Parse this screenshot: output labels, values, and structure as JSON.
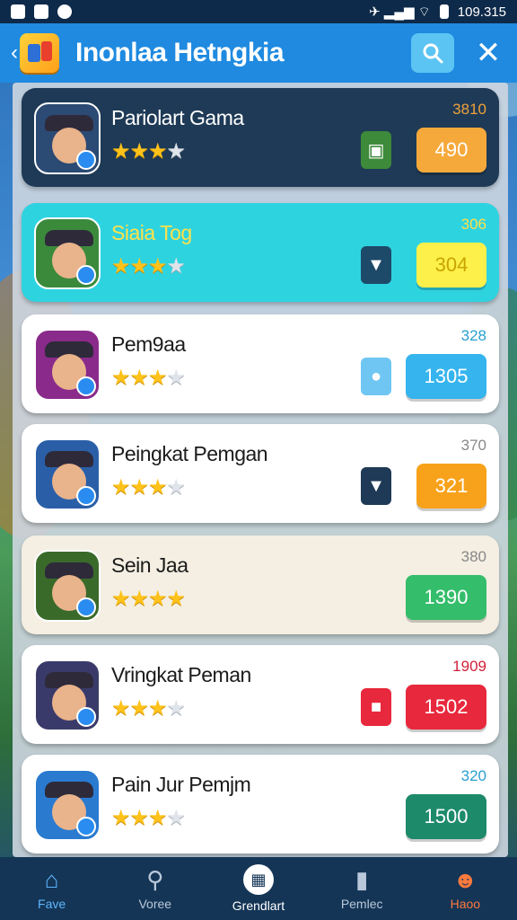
{
  "status_bar": {
    "time": "109.315"
  },
  "header": {
    "title": "Inonlaa Hetngkia"
  },
  "players": [
    {
      "name": "Pariolart Gama",
      "score": "3810",
      "button": "490",
      "stars": 3,
      "card_bg": "#1e3a56",
      "name_color": "#ffffff",
      "score_color": "#f2a23a",
      "btn_color": "#f6a93b",
      "small_color": "#3c8a3a",
      "small_icon": "▣"
    },
    {
      "name": "Siaia Tog",
      "score": "306",
      "button": "304",
      "stars": 3,
      "card_bg": "#2ed3e0",
      "name_color": "#ffe14a",
      "score_color": "#ffe14a",
      "btn_color": "#fdf04a",
      "small_color": "#1e4a6a",
      "small_icon": "▼"
    },
    {
      "name": "Pem9aa",
      "score": "328",
      "button": "1305",
      "stars": 3,
      "card_bg": "#ffffff",
      "name_color": "#1b1b1b",
      "score_color": "#2a9fd0",
      "btn_color": "#35b4ee",
      "small_color": "#6fc6f2",
      "small_icon": "●"
    },
    {
      "name": "Peingkat Pemgan",
      "score": "370",
      "button": "321",
      "stars": 3,
      "card_bg": "#ffffff",
      "name_color": "#1b1b1b",
      "score_color": "#888888",
      "btn_color": "#f7a21a",
      "small_color": "#1e3a56",
      "small_icon": "▼"
    },
    {
      "name": "Sein Jaa",
      "score": "380",
      "button": "1390",
      "stars": 4,
      "card_bg": "#f4efe2",
      "name_color": "#1b1b1b",
      "score_color": "#888888",
      "btn_color": "#34bd6a",
      "small_color": "",
      "small_icon": ""
    },
    {
      "name": "Vringkat Peman",
      "score": "1909",
      "button": "1502",
      "stars": 3,
      "card_bg": "#ffffff",
      "name_color": "#1b1b1b",
      "score_color": "#d1203a",
      "btn_color": "#e8283c",
      "small_color": "#e8283c",
      "small_icon": "■"
    },
    {
      "name": "Pain Jur Pemjm",
      "score": "320",
      "button": "1500",
      "stars": 3,
      "card_bg": "#ffffff",
      "name_color": "#1b1b1b",
      "score_color": "#2a9fd0",
      "btn_color": "#1d8a6a",
      "small_color": "",
      "small_icon": ""
    }
  ],
  "nav": [
    {
      "label": "Fave",
      "icon": "home-icon"
    },
    {
      "label": "Voree",
      "icon": "search-icon"
    },
    {
      "label": "Grendlart",
      "icon": "grid-icon"
    },
    {
      "label": "Pemlec",
      "icon": "trophy-icon"
    },
    {
      "label": "Haoo",
      "icon": "profile-icon"
    }
  ]
}
